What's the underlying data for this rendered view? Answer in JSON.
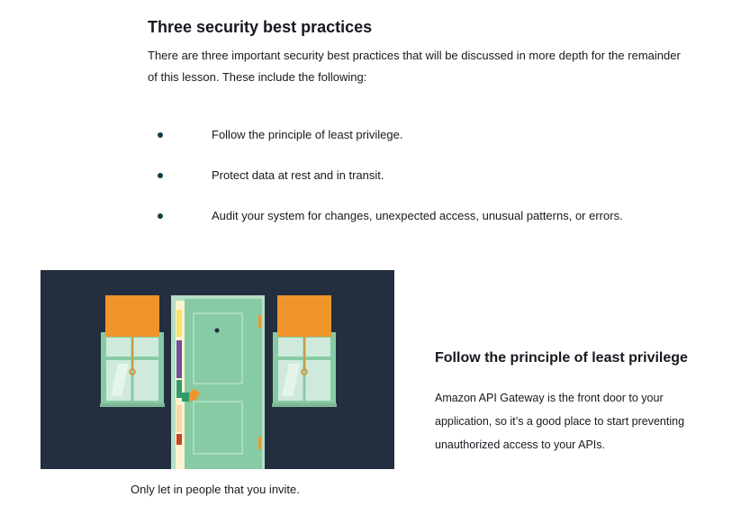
{
  "section": {
    "title": "Three security best practices",
    "intro": "There are three important security best practices that will be discussed in more depth for the remainder of this lesson. These include the following:"
  },
  "practices": [
    {
      "text": "Follow the principle of least privilege."
    },
    {
      "text": "Protect data at rest and in transit."
    },
    {
      "text": "Audit your system for changes, unexpected access, unusual patterns, or errors."
    }
  ],
  "illustration": {
    "caption": "Only let in people that you invite.",
    "colors": {
      "background": "#232f3e",
      "window_shade": "#f0952b",
      "door": "#87cba4",
      "window_glass": "#cfeadc"
    }
  },
  "least_privilege": {
    "title": "Follow the principle of least privilege",
    "body": "Amazon API Gateway is the front door to your application, so it’s a good place to start preventing unauthorized access to your APIs."
  },
  "colors": {
    "bullet": "#0f3d4a",
    "text": "#16191f"
  }
}
